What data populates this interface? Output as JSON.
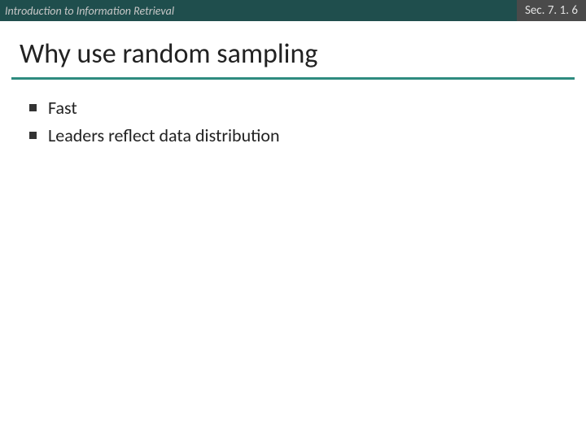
{
  "header": {
    "left": "Introduction to Information Retrieval",
    "right": "Sec. 7. 1. 6"
  },
  "title": "Why use random sampling",
  "bullets": {
    "item0": "Fast",
    "item1": "Leaders reflect data distribution"
  }
}
